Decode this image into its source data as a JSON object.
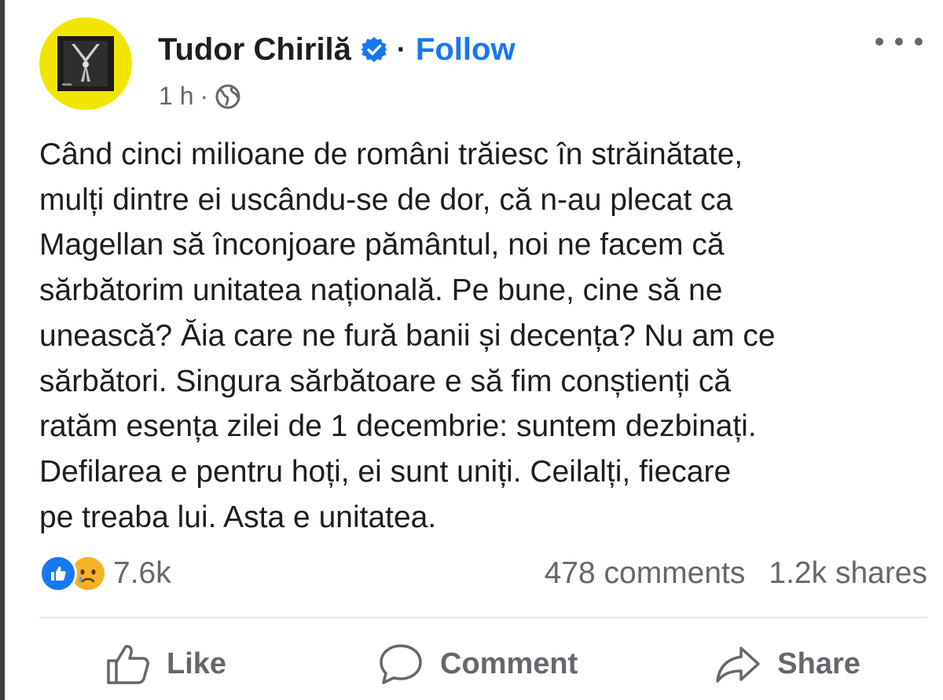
{
  "post": {
    "author": {
      "name": "Tudor Chirilă",
      "separator": "·",
      "follow_label": "Follow",
      "verified_icon": "verified-badge-icon"
    },
    "meta": {
      "time": "1 h",
      "separator": "·",
      "audience_icon": "globe-icon"
    },
    "text_lines": [
      "Când cinci milioane de români trăiesc în străinătate,",
      "mulți dintre ei uscându-se de dor, că n-au plecat ca",
      "Magellan să înconjoare pământul, noi ne facem că",
      "sărbătorim unitatea națională. Pe bune, cine să ne",
      "unească? Ăia care ne fură banii și decența? Nu am ce",
      "sărbători. Singura sărbătoare e să fim conștienți că",
      "ratăm esența zilei de 1 decembrie: suntem dezbinați.",
      "Defilarea e pentru hoți, ei sunt uniți. Ceilalți, fiecare",
      "pe treaba lui. Asta e unitatea."
    ],
    "stats": {
      "reactions_count": "7.6k",
      "reaction_icons": [
        "like-reaction-icon",
        "sad-reaction-icon"
      ],
      "comments": "478 comments",
      "shares": "1.2k shares"
    },
    "actions": {
      "like_label": "Like",
      "comment_label": "Comment",
      "share_label": "Share"
    }
  },
  "colors": {
    "link_blue": "#1877f2",
    "avatar_yellow": "#f2e600",
    "secondary_text": "#65676b",
    "sad_reaction": "#f7b125"
  }
}
